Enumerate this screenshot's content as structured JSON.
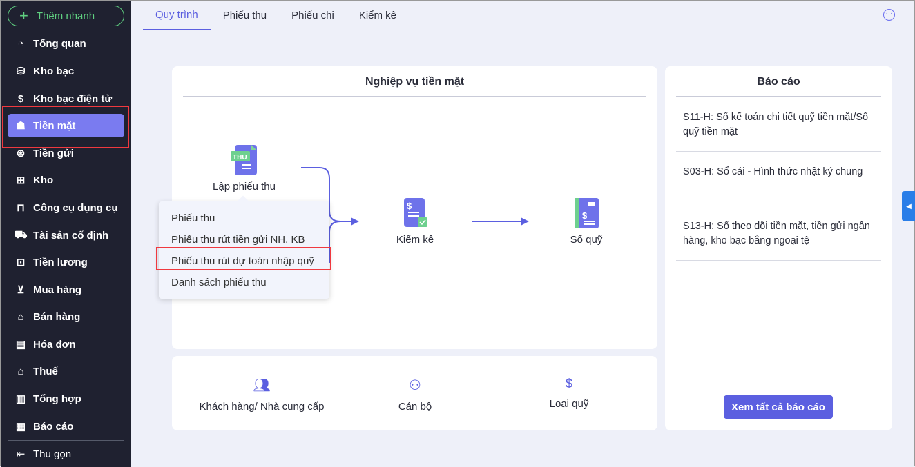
{
  "sidebar": {
    "quick_add": "Thêm nhanh",
    "items": [
      {
        "label": "Tổng quan",
        "icon": "pie-chart-icon"
      },
      {
        "label": "Kho bạc",
        "icon": "treasury-icon"
      },
      {
        "label": "Kho bạc điện tử",
        "icon": "e-treasury-icon"
      },
      {
        "label": "Tiền mặt",
        "icon": "cash-icon",
        "active": true
      },
      {
        "label": "Tiền gửi",
        "icon": "deposit-icon"
      },
      {
        "label": "Kho",
        "icon": "warehouse-icon"
      },
      {
        "label": "Công cụ dụng cụ",
        "icon": "tools-icon"
      },
      {
        "label": "Tài sản cố định",
        "icon": "truck-icon"
      },
      {
        "label": "Tiền lương",
        "icon": "briefcase-icon"
      },
      {
        "label": "Mua hàng",
        "icon": "cart-icon"
      },
      {
        "label": "Bán hàng",
        "icon": "store-icon"
      },
      {
        "label": "Hóa đơn",
        "icon": "invoice-icon"
      },
      {
        "label": "Thuế",
        "icon": "bank-icon"
      },
      {
        "label": "Tổng hợp",
        "icon": "book-icon"
      },
      {
        "label": "Báo cáo",
        "icon": "report-icon"
      }
    ],
    "collapse": "Thu gọn"
  },
  "tabs": [
    "Quy trình",
    "Phiếu thu",
    "Phiếu chi",
    "Kiểm kê"
  ],
  "process": {
    "title": "Nghiệp vụ tiền mặt",
    "node1": "Lập phiếu thu",
    "node1_badge": "THU",
    "node2": "Kiểm kê",
    "node3": "Sổ quỹ",
    "menu": [
      "Phiếu thu",
      "Phiếu thu rút tiền gửi NH, KB",
      "Phiếu thu rút dự toán nhập quỹ",
      "Danh sách phiếu thu"
    ]
  },
  "categories": [
    "Khách hàng/ Nhà cung cấp",
    "Cán bộ",
    "Loại quỹ"
  ],
  "reports": {
    "title": "Báo cáo",
    "items": [
      "S11-H: Sổ kế toán chi tiết quỹ tiền mặt/Sổ quỹ tiền mặt",
      "S03-H: Sổ cái - Hình thức nhật ký chung",
      "S13-H: Sổ theo dõi tiền mặt, tiền gửi ngân hàng, kho bạc bằng ngoại tệ"
    ],
    "view_all": "Xem tất cả báo cáo"
  },
  "colors": {
    "accent": "#5b5fe0",
    "sidebar_bg": "#1f2130",
    "active_item": "#7a7bf0",
    "highlight": "#f0393f",
    "green": "#5fcf80"
  }
}
